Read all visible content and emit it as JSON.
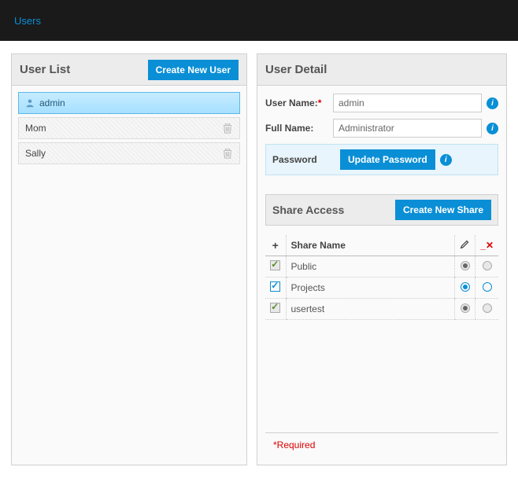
{
  "topbar": {
    "title": "Users"
  },
  "user_list": {
    "title": "User List",
    "create_label": "Create New User",
    "users": [
      {
        "name": "admin",
        "selected": true,
        "deletable": false
      },
      {
        "name": "Mom",
        "selected": false,
        "deletable": true
      },
      {
        "name": "Sally",
        "selected": false,
        "deletable": true
      }
    ]
  },
  "user_detail": {
    "title": "User Detail",
    "username_label": "User Name:",
    "username_value": "admin",
    "fullname_label": "Full Name:",
    "fullname_value": "Administrator",
    "password_label": "Password",
    "update_password_label": "Update Password"
  },
  "share_access": {
    "title": "Share Access",
    "create_label": "Create New Share",
    "col_add": "+",
    "col_name": "Share Name",
    "shares": [
      {
        "name": "Public",
        "added": true,
        "enabled": false,
        "read": true,
        "write": false
      },
      {
        "name": "Projects",
        "added": true,
        "enabled": true,
        "read": true,
        "write": false
      },
      {
        "name": "usertest",
        "added": true,
        "enabled": false,
        "read": true,
        "write": false
      }
    ]
  },
  "footer": {
    "required_note": "*Required"
  }
}
